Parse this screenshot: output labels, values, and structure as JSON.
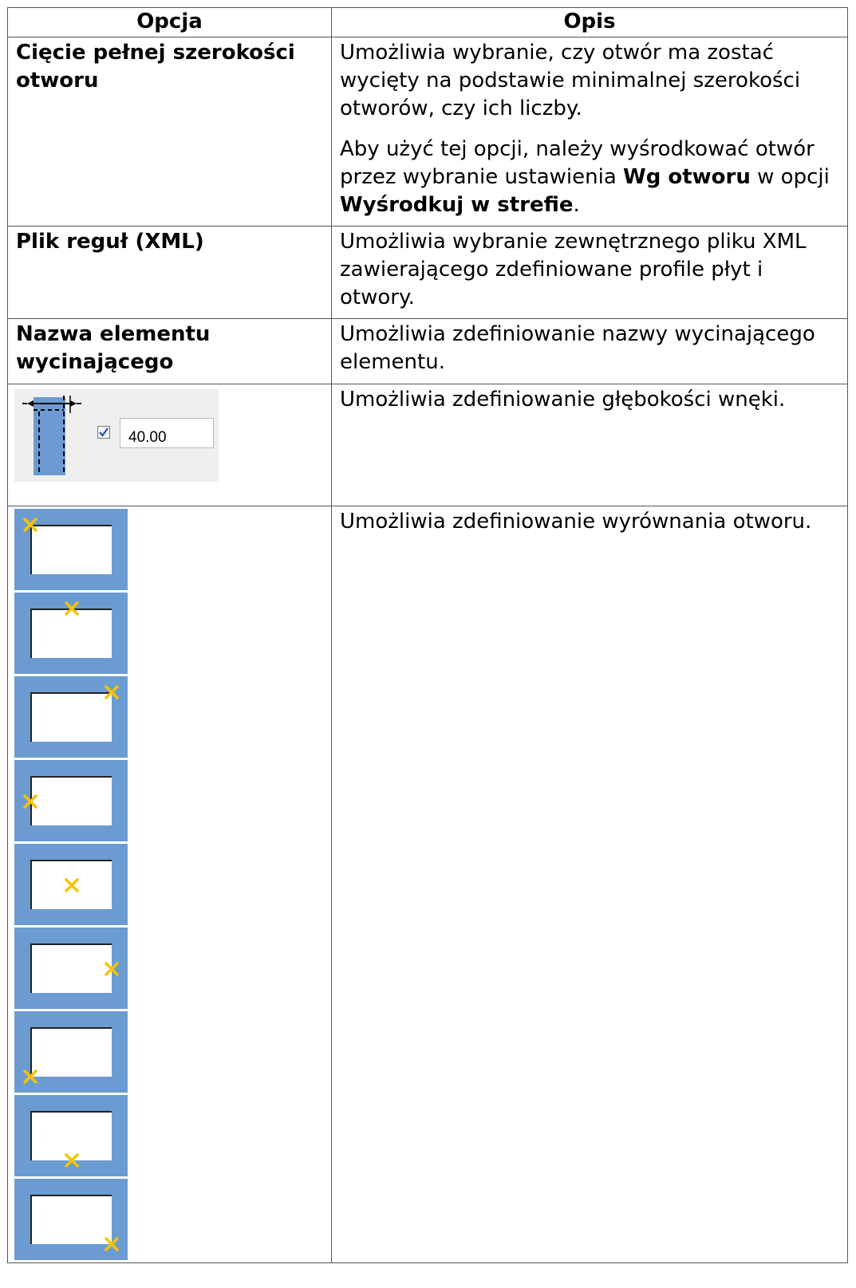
{
  "header": {
    "col_option": "Opcja",
    "col_desc": "Opis"
  },
  "rows": [
    {
      "name": "Cięcie pełnej szerokości otworu",
      "desc_p1": "Umożliwia wybranie, czy otwór ma zostać wycięty na podstawie minimalnej szerokości otworów, czy ich liczby.",
      "desc_p2_a": "Aby użyć tej opcji, należy wyśrodkować otwór przez wybranie ustawienia ",
      "desc_p2_b": "Wg otworu",
      "desc_p2_c": " w opcji ",
      "desc_p2_d": "Wyśrodkuj w strefie",
      "desc_p2_e": "."
    },
    {
      "name": "Plik reguł (XML)",
      "desc": "Umożliwia wybranie zewnętrznego pliku XML zawierającego zdefiniowane profile płyt i otwory."
    },
    {
      "name": "Nazwa elementu wycinającego",
      "desc": "Umożliwia zdefiniowanie nazwy wycinającego elementu."
    },
    {
      "desc": "Umożliwia zdefiniowanie głębokości wnęki.",
      "checkbox_checked": true,
      "value": "40.00"
    },
    {
      "desc": "Umożliwia zdefiniowanie wyrównania otworu."
    }
  ],
  "alignment_options": [
    "top-left",
    "top-center",
    "top-right",
    "middle-left",
    "middle-center",
    "middle-right",
    "bottom-left",
    "bottom-center",
    "bottom-right"
  ],
  "colors": {
    "icon_blue": "#6b9bd1",
    "marker_yellow": "#f5c400"
  }
}
